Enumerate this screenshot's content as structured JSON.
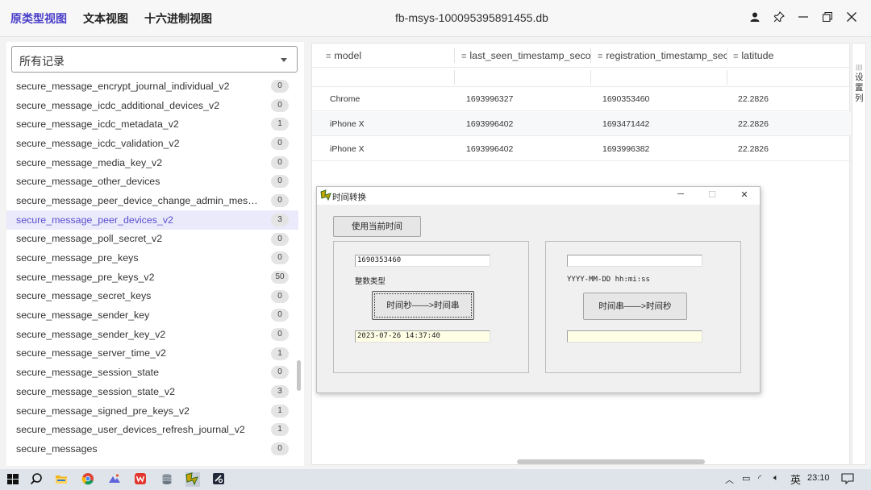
{
  "header": {
    "tabs": [
      "原类型视图",
      "文本视图",
      "十六进制视图"
    ],
    "db_title": "fb-msys-100095395891455.db"
  },
  "sidebar": {
    "filter_value": "所有记录",
    "items": [
      {
        "name": "secure_message_encrypt_journal_individual_v2",
        "count": "0"
      },
      {
        "name": "secure_message_icdc_additional_devices_v2",
        "count": "0"
      },
      {
        "name": "secure_message_icdc_metadata_v2",
        "count": "1"
      },
      {
        "name": "secure_message_icdc_validation_v2",
        "count": "0"
      },
      {
        "name": "secure_message_media_key_v2",
        "count": "0"
      },
      {
        "name": "secure_message_other_devices",
        "count": "0"
      },
      {
        "name": "secure_message_peer_device_change_admin_messag...",
        "count": "0"
      },
      {
        "name": "secure_message_peer_devices_v2",
        "count": "3"
      },
      {
        "name": "secure_message_poll_secret_v2",
        "count": "0"
      },
      {
        "name": "secure_message_pre_keys",
        "count": "0"
      },
      {
        "name": "secure_message_pre_keys_v2",
        "count": "50"
      },
      {
        "name": "secure_message_secret_keys",
        "count": "0"
      },
      {
        "name": "secure_message_sender_key",
        "count": "0"
      },
      {
        "name": "secure_message_sender_key_v2",
        "count": "0"
      },
      {
        "name": "secure_message_server_time_v2",
        "count": "1"
      },
      {
        "name": "secure_message_session_state",
        "count": "0"
      },
      {
        "name": "secure_message_session_state_v2",
        "count": "3"
      },
      {
        "name": "secure_message_signed_pre_keys_v2",
        "count": "1"
      },
      {
        "name": "secure_message_user_devices_refresh_journal_v2",
        "count": "1"
      },
      {
        "name": "secure_messages",
        "count": "0"
      }
    ],
    "selected_index": 7
  },
  "table": {
    "columns": [
      "model",
      "last_seen_timestamp_secon",
      "registration_timestamp_sec",
      "latitude"
    ],
    "rows": [
      [
        "Chrome",
        "1693996327",
        "1690353460",
        "22.2826"
      ],
      [
        "iPhone X",
        "1693996402",
        "1693471442",
        "22.2826"
      ],
      [
        "iPhone X",
        "1693996402",
        "1693996382",
        "22.2826"
      ]
    ],
    "side_label": "设置列"
  },
  "dialog": {
    "title": "时间转换",
    "use_current_button": "使用当前时间",
    "left": {
      "input_value": "1690353460",
      "type_label": "整数类型",
      "convert_button": "时间秒——>时间串",
      "result_value": "2023-07-26 14:37:40"
    },
    "right": {
      "input_value": "",
      "format_label": "YYYY-MM-DD hh:mi:ss",
      "convert_button": "时间串——>时间秒",
      "result_value": ""
    }
  },
  "taskbar": {
    "ime": "英",
    "clock": "23:10"
  },
  "colors": {
    "accent": "#4a3fc9",
    "selected_row_bg": "#ebeafb"
  }
}
